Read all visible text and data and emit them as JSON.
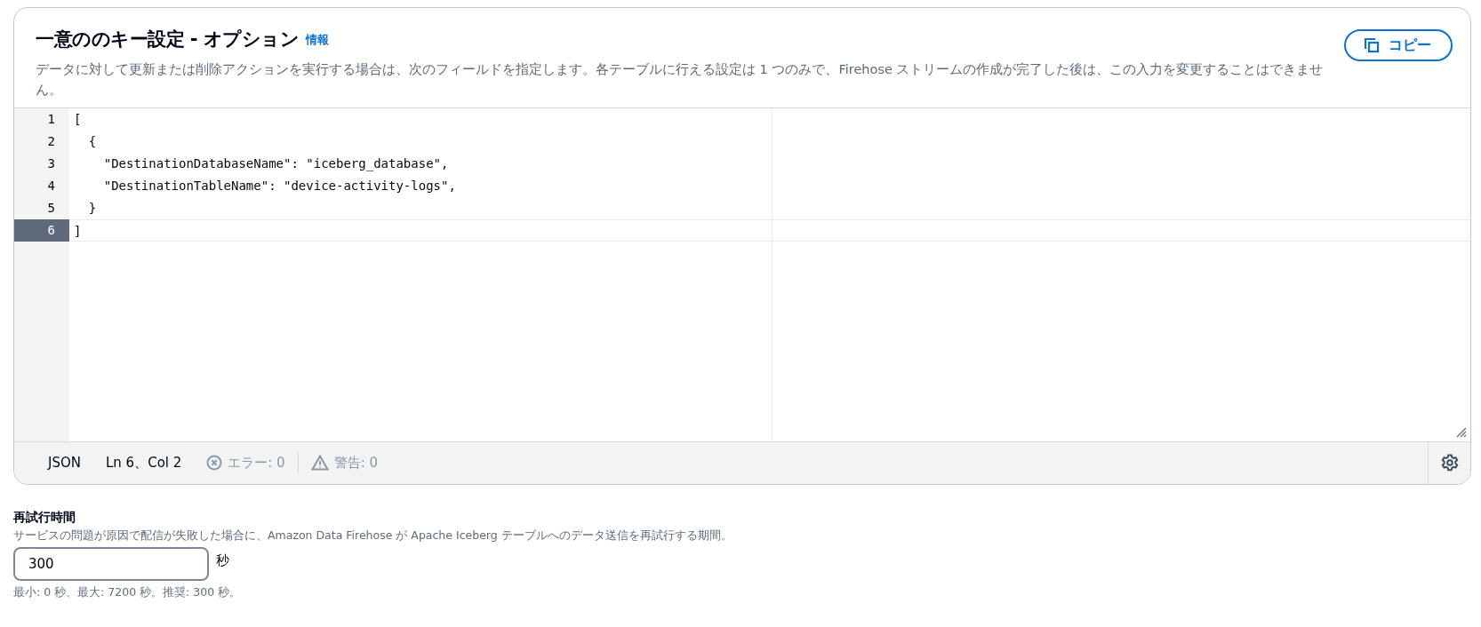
{
  "header": {
    "title": "一意ののキー設定 - オプション",
    "info_link": "情報",
    "description": "データに対して更新または削除アクションを実行する場合は、次のフィールドを指定します。各テーブルに行える設定は 1 つのみで、Firehose ストリームの作成が完了した後は、この入力を変更することはできません。",
    "copy_button": "コピー"
  },
  "editor": {
    "lines": [
      {
        "number": "1",
        "text": "[",
        "active": false
      },
      {
        "number": "2",
        "text": "  {",
        "active": false
      },
      {
        "number": "3",
        "text": "    \"DestinationDatabaseName\": \"iceberg_database\",",
        "active": false
      },
      {
        "number": "4",
        "text": "    \"DestinationTableName\": \"device-activity-logs\",",
        "active": false
      },
      {
        "number": "5",
        "text": "  }",
        "active": false
      },
      {
        "number": "6",
        "text": "]",
        "active": true
      }
    ],
    "status": {
      "language": "JSON",
      "cursor": "Ln 6、Col 2",
      "errors": "エラー: 0",
      "warnings": "警告: 0"
    }
  },
  "retry": {
    "label": "再試行時間",
    "description": "サービスの問題が原因で配信が失敗した場合に、Amazon Data Firehose が Apache Iceberg テーブルへのデータ送信を再試行する期間。",
    "value": "300",
    "unit": "秒",
    "hint": "最小: 0 秒、最大: 7200 秒。推奨: 300 秒。"
  }
}
